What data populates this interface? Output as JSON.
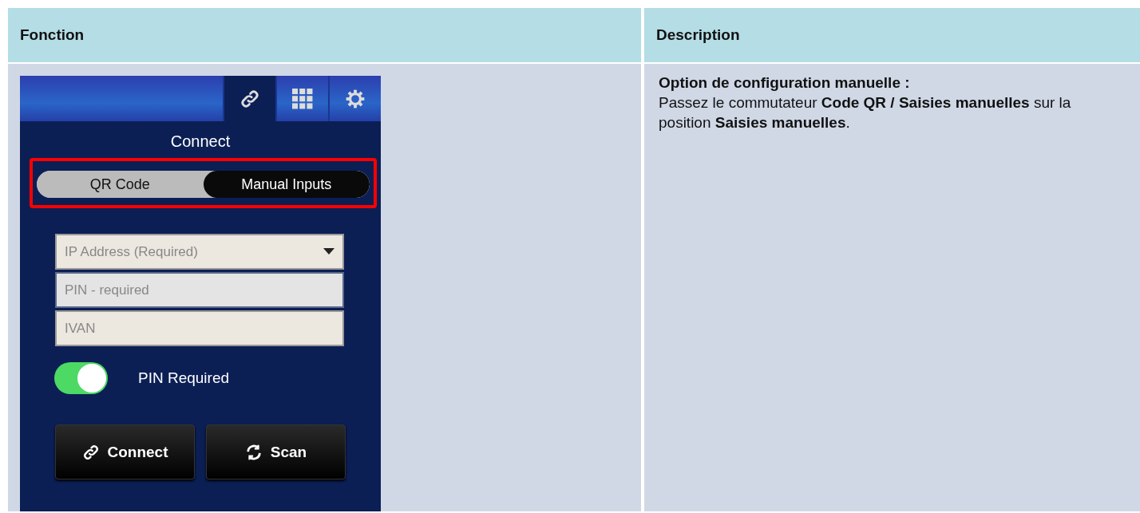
{
  "table": {
    "columns": [
      {
        "label": "Fonction"
      },
      {
        "label": "Description"
      }
    ],
    "rows": [
      {
        "app": {
          "tabs": [
            {
              "kind": "link",
              "selected": true
            },
            {
              "kind": "grid",
              "selected": false
            },
            {
              "kind": "gear",
              "selected": false
            }
          ],
          "title": "Connect",
          "mode_switch": {
            "highlighted": true,
            "segments": [
              {
                "label": "QR Code",
                "selected": false
              },
              {
                "label": "Manual Inputs",
                "selected": true
              }
            ]
          },
          "fields": [
            {
              "kind": "dropdown",
              "placeholder": "IP Address (Required)",
              "focused": false
            },
            {
              "kind": "text",
              "placeholder": "PIN - required",
              "focused": true
            },
            {
              "kind": "text",
              "placeholder": "IVAN",
              "focused": false
            }
          ],
          "toggle": {
            "label": "PIN Required",
            "on": true
          },
          "buttons": [
            {
              "kind": "link",
              "label": "Connect"
            },
            {
              "kind": "refresh",
              "label": "Scan"
            }
          ]
        },
        "description": {
          "title": "Option de configuration manuelle :",
          "text": "Passez le commutateur **Code QR / Saisies manuelles** sur la position **Saisies manuelles**."
        }
      }
    ]
  }
}
